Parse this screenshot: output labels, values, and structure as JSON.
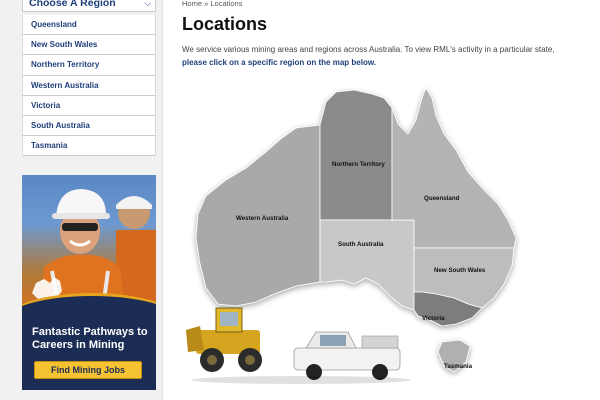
{
  "sidebar": {
    "header": "Choose A Region",
    "regions": [
      {
        "label": "Queensland"
      },
      {
        "label": "New South Wales"
      },
      {
        "label": "Northern Territory"
      },
      {
        "label": "Western Australia"
      },
      {
        "label": "Victoria"
      },
      {
        "label": "South Australia"
      },
      {
        "label": "Tasmania"
      }
    ]
  },
  "banner": {
    "headline": "Fantastic Pathways to Careers in Mining",
    "button": "Find Mining Jobs"
  },
  "breadcrumb": {
    "home": "Home",
    "separator": "»",
    "current": "Locations"
  },
  "page": {
    "title": "Locations",
    "intro": "We service various mining areas and regions across Australia. To view RML's activity in a particular state,",
    "intro_link": "please click on a specific region on the map below."
  },
  "map": {
    "regions": {
      "northern_territory": "Northern Territory",
      "queensland": "Queensland",
      "western_australia": "Western Australia",
      "south_australia": "South Australia",
      "new_south_wales": "New South Wales",
      "victoria": "Victoria",
      "tasmania": "Tasmania"
    }
  },
  "colors": {
    "link": "#1f3f7a",
    "banner_bg": "#1b2c55",
    "button": "#f5c232"
  }
}
